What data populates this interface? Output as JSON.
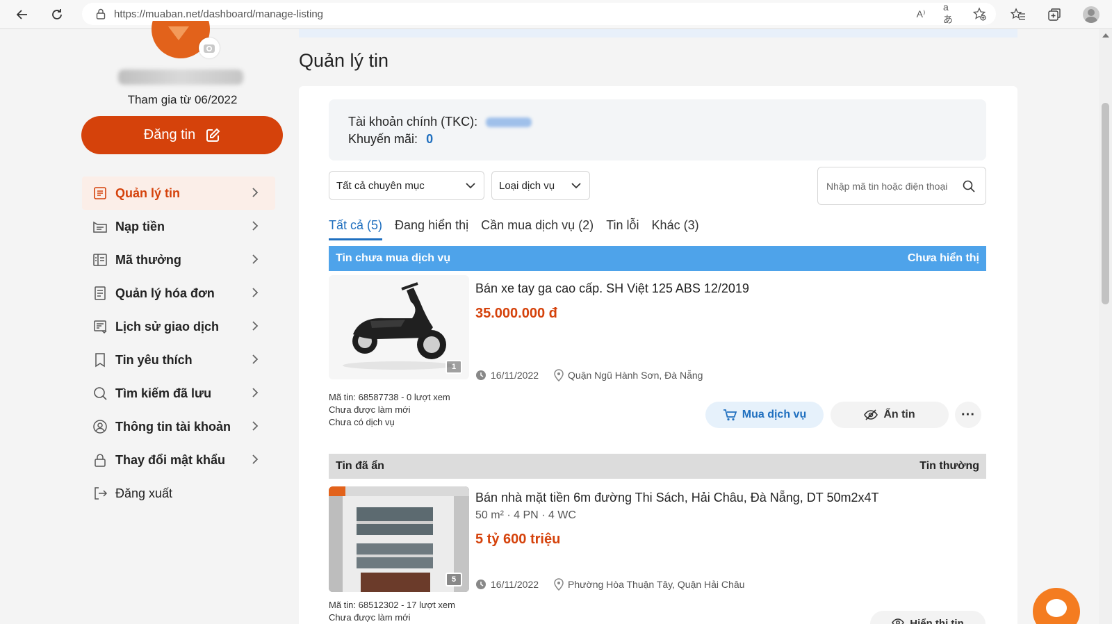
{
  "browser": {
    "url": "https://muaban.net/dashboard/manage-listing",
    "icons": [
      "back-icon",
      "reload-icon",
      "lock-icon",
      "read-aloud-icon",
      "translate-icon",
      "add-favorite-icon",
      "favorites-icon",
      "collections-icon",
      "profile-icon"
    ],
    "read_aloud_glyph": "A⁾",
    "translate_glyph": "aあ"
  },
  "sidebar": {
    "join_text": "Tham gia từ 06/2022",
    "post_button": "Đăng tin",
    "menu": [
      {
        "label": "Quản lý tin",
        "icon": "manage-listing-icon",
        "active": true
      },
      {
        "label": "Nạp tiền",
        "icon": "topup-icon"
      },
      {
        "label": "Mã thưởng",
        "icon": "voucher-icon"
      },
      {
        "label": "Quản lý hóa đơn",
        "icon": "invoice-icon"
      },
      {
        "label": "Lịch sử giao dịch",
        "icon": "transaction-history-icon"
      },
      {
        "label": "Tin yêu thích",
        "icon": "bookmark-icon"
      },
      {
        "label": "Tìm kiếm đã lưu",
        "icon": "search-icon"
      },
      {
        "label": "Thông tin tài khoản",
        "icon": "account-icon"
      },
      {
        "label": "Thay đổi mật khẩu",
        "icon": "lock-icon"
      },
      {
        "label": "Đăng xuất",
        "icon": "logout-icon"
      }
    ]
  },
  "main": {
    "title": "Quản lý tin",
    "balance": {
      "main_account_label": "Tài khoản chính (TKC):",
      "promo_label": "Khuyến mãi:",
      "promo_value": "0"
    },
    "filters": {
      "category": "Tất cả chuyên mục",
      "service": "Loại dịch vụ",
      "search_placeholder": "Nhập mã tin hoặc điện thoại"
    },
    "tabs": [
      "Tất cả (5)",
      "Đang hiển thị",
      "Cần mua dịch vụ (2)",
      "Tin lỗi",
      "Khác (3)"
    ],
    "listings": [
      {
        "band_left": "Tin chưa mua dịch vụ",
        "band_right": "Chưa hiển thị",
        "title": "Bán xe tay ga cao cấp. SH Việt 125 ABS 12/2019",
        "price": "35.000.000 đ",
        "image_count": "1",
        "date": "16/11/2022",
        "location": "Quận Ngũ Hành Sơn, Đà Nẵng",
        "info": [
          "Mã tin: 68587738 - 0 lượt xem",
          "Chưa được làm mới",
          "Chưa có dịch vụ"
        ],
        "actions": {
          "buy": "Mua dịch vụ",
          "hide": "Ẩn tin",
          "more": "···"
        }
      },
      {
        "band_left": "Tin đã ẩn",
        "band_right": "Tin thường",
        "title": "Bán nhà mặt tiền 6m đường Thi Sách, Hải Châu, Đà Nẵng, DT 50m2x4T",
        "specs": "50 m² · 4 PN · 4 WC",
        "price": "5 tỷ 600 triệu",
        "image_count": "5",
        "date": "16/11/2022",
        "location": "Phường Hòa Thuận Tây, Quận Hải Châu",
        "info": [
          "Mã tin: 68512302 - 17 lượt xem",
          "Chưa được làm mới"
        ],
        "actions": {
          "show": "Hiển thị tin"
        }
      }
    ]
  },
  "colors": {
    "accent": "#d5420b",
    "link": "#1f6fbf",
    "band_blue": "#4ea3ea",
    "chat": "#f47c20"
  }
}
